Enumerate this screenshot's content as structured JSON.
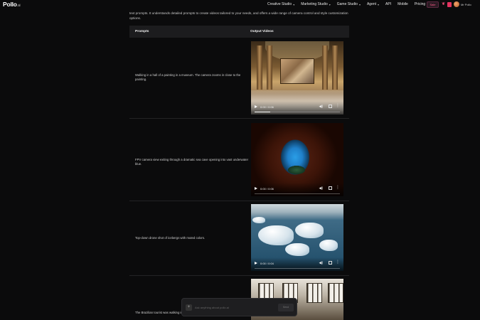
{
  "brand": {
    "name": "Pollo",
    "suffix": ".ai"
  },
  "nav": {
    "items": [
      {
        "label": "Creative Studio",
        "dropdown": true
      },
      {
        "label": "Marketing Studio",
        "dropdown": true
      },
      {
        "label": "Game Studio",
        "dropdown": true
      },
      {
        "label": "Agent",
        "dropdown": true
      },
      {
        "label": "API",
        "dropdown": false
      },
      {
        "label": "Mobile",
        "dropdown": false
      },
      {
        "label": "Pricing",
        "dropdown": false
      }
    ],
    "credits": "Sale",
    "user_name": "Mr Pollo"
  },
  "intro": "text prompts. It understands detailed prompts to create videos tailored to your needs, and offers a wide range of camera control and style customization options.",
  "table": {
    "headers": {
      "prompts": "Prompts",
      "output": "Output Videos"
    },
    "rows": [
      {
        "prompt": "Walking in a hall of a painting in a museum. The camera zooms in close to the painting.",
        "time": "0:00 / 0:06",
        "progress": 0.18
      },
      {
        "prompt": "FPV camera view exiting through a dramatic sea cave opening into vast underwater blue.",
        "time": "0:00 / 0:06",
        "progress": 0.0
      },
      {
        "prompt": "Top-down drone shot of icebergs with muted colors.",
        "time": "0:00 / 0:04",
        "progress": 0.0
      },
      {
        "prompt": "The Brazilian tourist was walking in a vast and dreamy old mansion",
        "time": "",
        "progress": 0.0
      }
    ]
  },
  "chat": {
    "placeholder": "Ask anything about pollo.ai",
    "send_label": "Send"
  }
}
